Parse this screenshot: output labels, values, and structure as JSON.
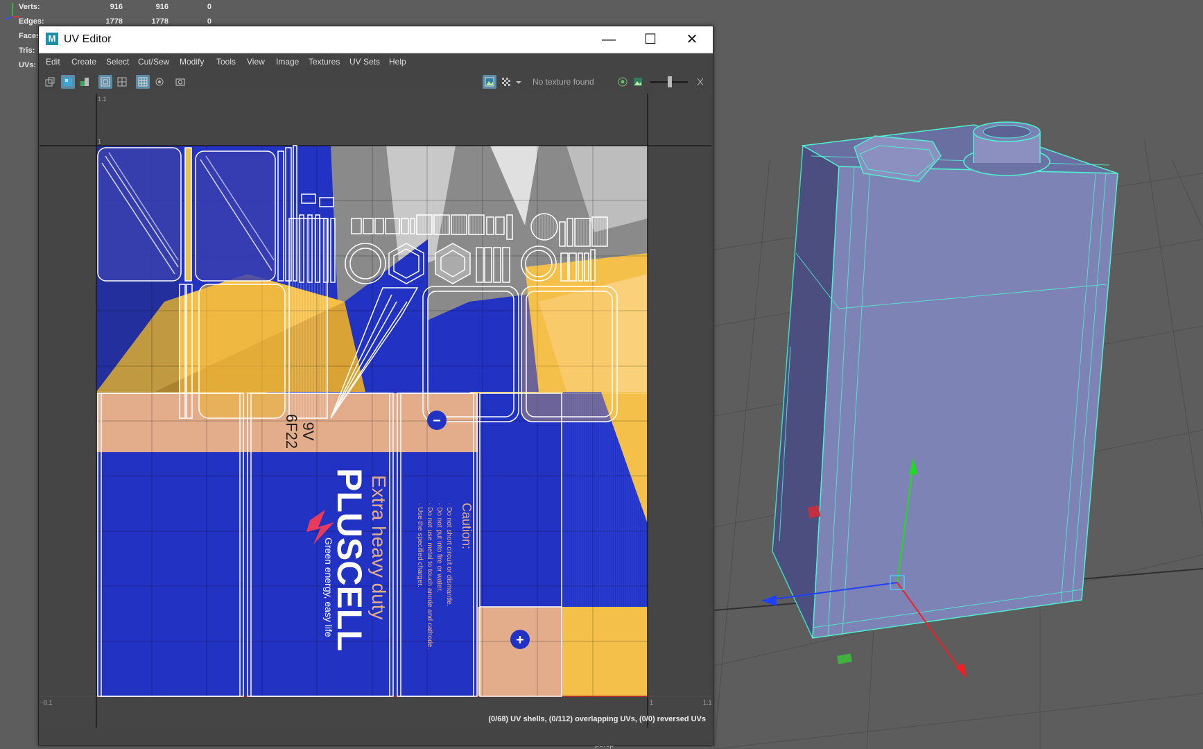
{
  "hud": {
    "rows": [
      {
        "label": "Verts:",
        "a": "916",
        "b": "916",
        "c": "0"
      },
      {
        "label": "Edges:",
        "a": "1778",
        "b": "1778",
        "c": "0"
      },
      {
        "label": "Faces:",
        "a": "",
        "b": "",
        "c": ""
      },
      {
        "label": "Tris:",
        "a": "",
        "b": "",
        "c": ""
      },
      {
        "label": "UVs:",
        "a": "",
        "b": "",
        "c": ""
      }
    ]
  },
  "viewport": {
    "camera_label": "persp"
  },
  "uv_editor": {
    "title": "UV Editor",
    "app_icon_letter": "M",
    "window_controls": {
      "minimize": "—",
      "maximize": "☐",
      "close": "✕"
    },
    "menus": [
      "Edit",
      "Create",
      "Select",
      "Cut/Sew",
      "Modify",
      "Tools",
      "View",
      "Image",
      "Textures",
      "UV Sets",
      "Help"
    ],
    "texture_status": "No texture found",
    "grid_labels": {
      "top_left": "1.1",
      "one": "1",
      "bottom_left": "-0.1",
      "bottom_mid": "1",
      "bottom_right": "1.1"
    },
    "texture_text": {
      "voltage": "9V",
      "model": "6F22",
      "brand": "PLUSCELL",
      "tagline": "Extra heavy duty",
      "slogan": "Green energy, easy life",
      "caution_title": "Caution:",
      "caution_lines": [
        "· Do not short circuit or dismantle.",
        "· Do not put into fire or water.",
        "· Do not use metal to touch anode and cathode.",
        "· Use the specified charger."
      ],
      "minus": "−",
      "plus": "+"
    },
    "status_line": "(0/68) UV shells, (0/112) overlapping UVs, (0/0) reversed UVs"
  },
  "colors": {
    "accent": "#5d8ca6",
    "texture_blue": "#2233c4",
    "texture_yellow": "#f5c04a",
    "texture_peach": "#e3ad8b",
    "wire_cyan": "#4ff0d0"
  }
}
